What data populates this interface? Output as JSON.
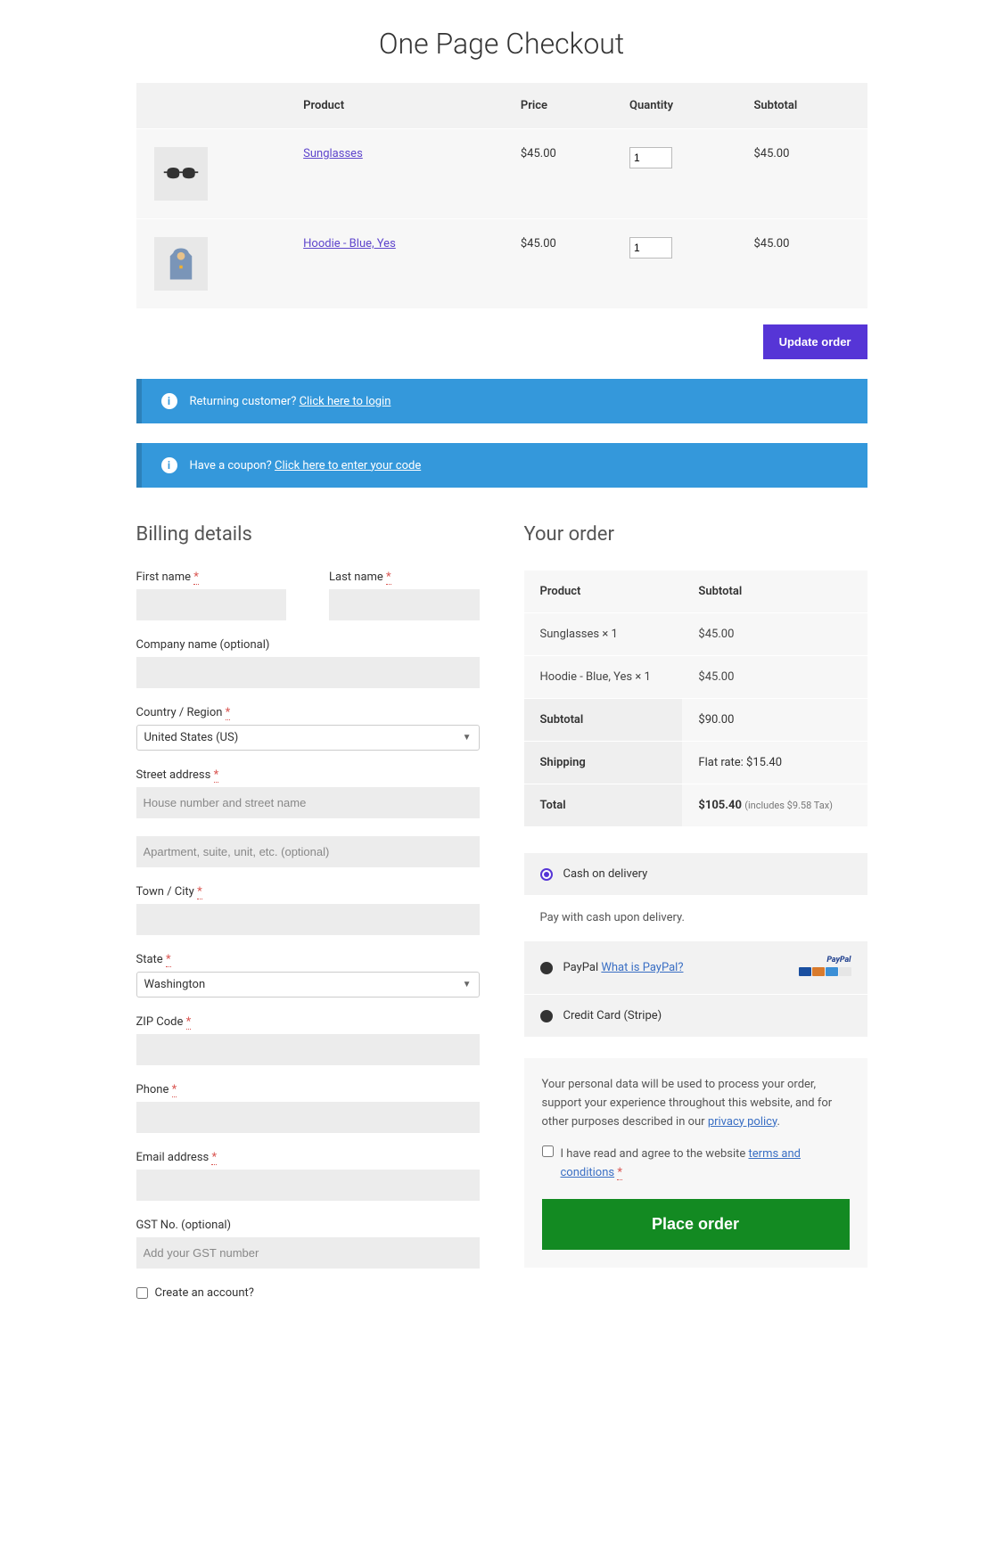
{
  "page_title": "One Page Checkout",
  "cart_headers": {
    "product": "Product",
    "price": "Price",
    "qty": "Quantity",
    "subtotal": "Subtotal"
  },
  "cart_items": [
    {
      "name": "Sunglasses",
      "price": "$45.00",
      "qty": "1",
      "subtotal": "$45.00"
    },
    {
      "name": "Hoodie - Blue, Yes",
      "price": "$45.00",
      "qty": "1",
      "subtotal": "$45.00"
    }
  ],
  "update_order_label": "Update order",
  "login_banner": {
    "text": "Returning customer? ",
    "link": "Click here to login"
  },
  "coupon_banner": {
    "text": "Have a coupon? ",
    "link": "Click here to enter your code"
  },
  "billing": {
    "heading": "Billing details",
    "first_name": "First name",
    "last_name": "Last name",
    "company": "Company name (optional)",
    "country_label": "Country / Region",
    "country_value": "United States (US)",
    "street_label": "Street address",
    "street_ph1": "House number and street name",
    "street_ph2": "Apartment, suite, unit, etc. (optional)",
    "city": "Town / City",
    "state_label": "State",
    "state_value": "Washington",
    "zip": "ZIP Code",
    "phone": "Phone",
    "email": "Email address",
    "gst_label": "GST No. (optional)",
    "gst_ph": "Add your GST number",
    "create_account": "Create an account?"
  },
  "order": {
    "heading": "Your order",
    "th_product": "Product",
    "th_subtotal": "Subtotal",
    "lines": [
      {
        "name": "Sunglasses  × 1",
        "amount": "$45.00"
      },
      {
        "name": "Hoodie - Blue, Yes  × 1",
        "amount": "$45.00"
      }
    ],
    "subtotal_label": "Subtotal",
    "subtotal_amount": "$90.00",
    "shipping_label": "Shipping",
    "shipping_amount": "Flat rate: $15.40",
    "total_label": "Total",
    "total_amount": "$105.40",
    "tax_note": "(includes $9.58 Tax)"
  },
  "payments": {
    "cod": "Cash on delivery",
    "cod_desc": "Pay with cash upon delivery.",
    "paypal": "PayPal",
    "paypal_link": "What is PayPal?",
    "stripe": "Credit Card (Stripe)"
  },
  "privacy": {
    "text": "Your personal data will be used to process your order, support your experience throughout this website, and for other purposes described in our ",
    "link": "privacy policy",
    "terms_text": "I have read and agree to the website ",
    "terms_link": "terms and conditions"
  },
  "place_order_label": "Place order"
}
